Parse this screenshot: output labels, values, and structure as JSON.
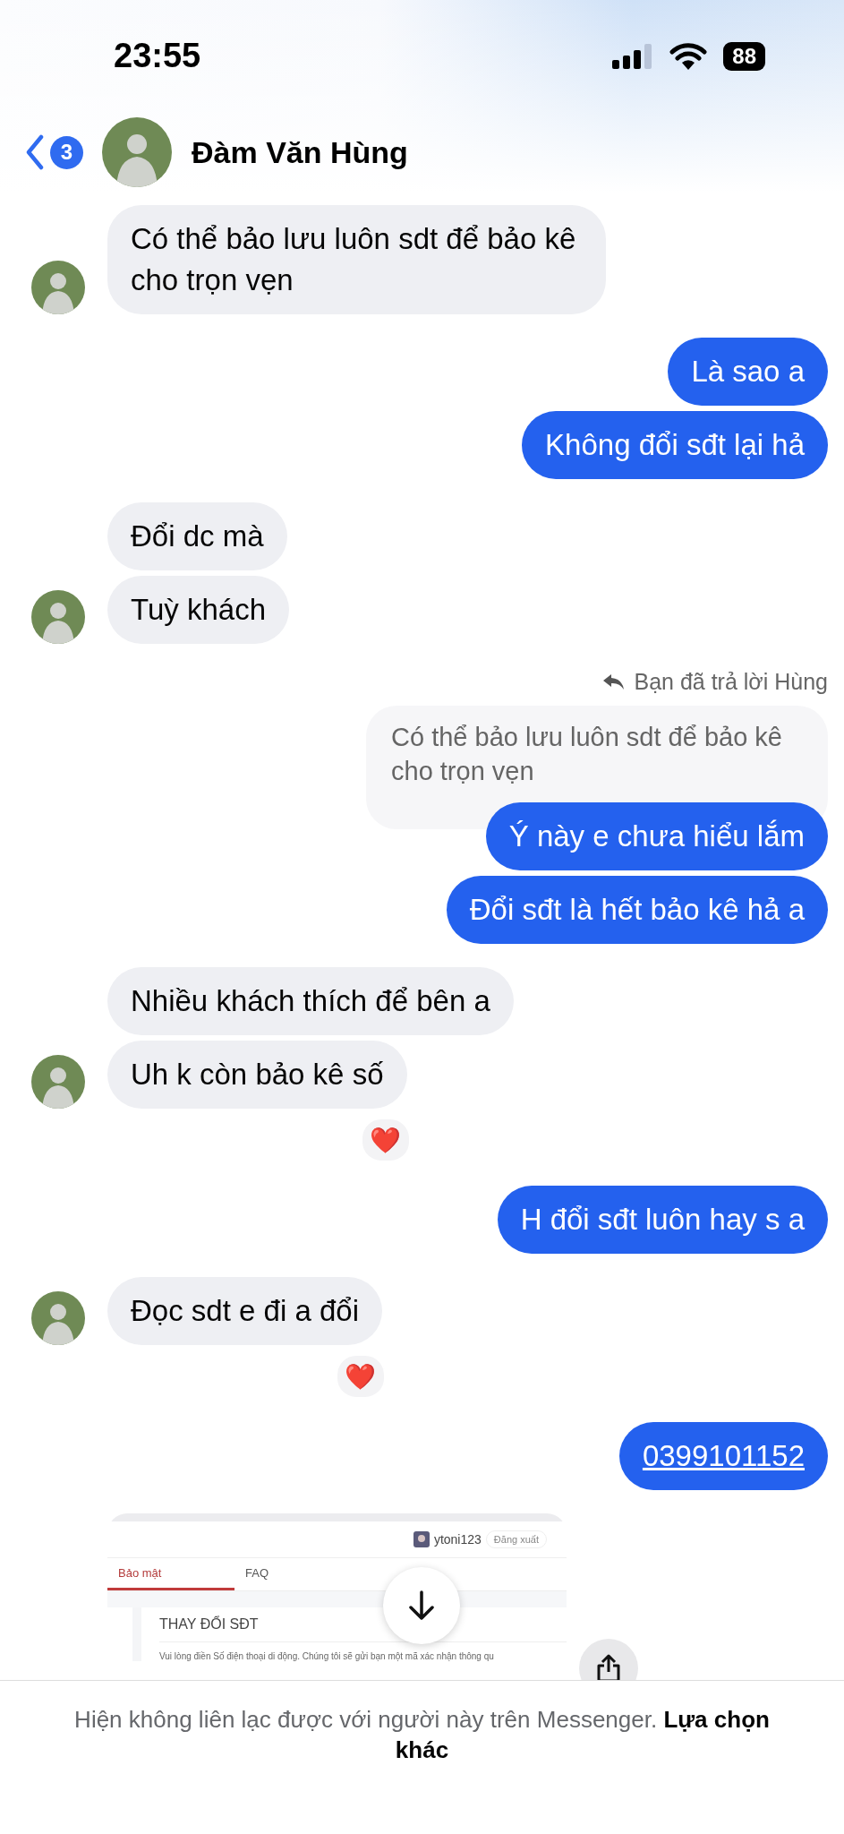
{
  "status_bar": {
    "time": "23:55",
    "battery": "88"
  },
  "header": {
    "unread_count": "3",
    "contact_name": "Đàm Văn Hùng"
  },
  "thread": [
    {
      "kind": "incoming",
      "messages": [
        {
          "kind": "text",
          "text": "Có thể bảo lưu luôn sdt để bảo kê cho trọn vẹn"
        }
      ]
    },
    {
      "kind": "outgoing",
      "messages": [
        {
          "kind": "text",
          "text": "Là sao a"
        },
        {
          "kind": "text",
          "text": "Không đổi sđt lại hả"
        }
      ]
    },
    {
      "kind": "incoming",
      "messages": [
        {
          "kind": "text",
          "text": "Đổi dc mà"
        },
        {
          "kind": "text",
          "text": "Tuỳ khách"
        }
      ]
    },
    {
      "kind": "outgoing",
      "reply": {
        "label": "Bạn đã trả lời Hùng",
        "quoted": "Có thể bảo lưu luôn sdt để bảo kê cho trọn vẹn"
      },
      "messages": [
        {
          "kind": "text",
          "text": "Ý này e chưa hiểu lắm"
        },
        {
          "kind": "text",
          "text": "Đổi sđt là hết bảo kê hả a"
        }
      ]
    },
    {
      "kind": "incoming",
      "messages": [
        {
          "kind": "text",
          "text": "Nhiều khách thích để bên a"
        },
        {
          "kind": "text",
          "text": "Uh k còn bảo kê số",
          "reaction": "❤️"
        }
      ]
    },
    {
      "kind": "outgoing",
      "messages": [
        {
          "kind": "text",
          "text": "H đổi sđt luôn hay s a"
        }
      ]
    },
    {
      "kind": "incoming",
      "messages": [
        {
          "kind": "text",
          "text": "Đọc sdt e đi a đổi",
          "reaction": "❤️"
        }
      ]
    },
    {
      "kind": "outgoing",
      "messages": [
        {
          "kind": "link",
          "text": "0399101152"
        }
      ]
    }
  ],
  "attachment": {
    "kind": "screenshot",
    "username": "ytoni123",
    "logout": "Đăng xuất",
    "tabs": [
      {
        "label": "Bảo mật",
        "selected": true
      },
      {
        "label": "FAQ",
        "selected": false
      }
    ],
    "heading": "THAY ĐỔI SĐT",
    "body": "Vui lòng điền Số điện thoại di động. Chúng tôi sẽ gửi bạn một mã xác nhận thông qu"
  },
  "footer": {
    "notice": "Hiện không liên lạc được với người này trên Messenger. **Lựa chọn khác**"
  }
}
